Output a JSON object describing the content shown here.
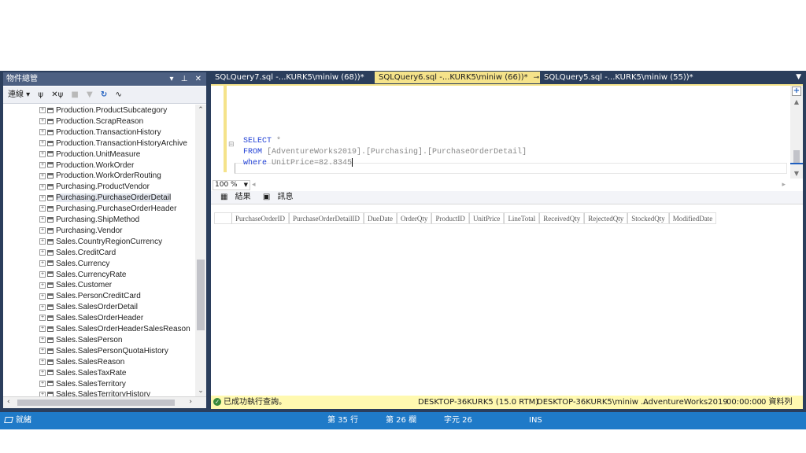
{
  "object_explorer": {
    "title": "物件總管",
    "title_buttons": "▾ ⊥ ✕",
    "toolbar": {
      "connect_label": "連線 ▾",
      "icons": [
        "plug-icon",
        "disconnect-icon",
        "stop-icon",
        "filter-icon",
        "refresh-icon",
        "activity-icon"
      ]
    },
    "items": [
      "Production.ProductSubcategory",
      "Production.ScrapReason",
      "Production.TransactionHistory",
      "Production.TransactionHistoryArchive",
      "Production.UnitMeasure",
      "Production.WorkOrder",
      "Production.WorkOrderRouting",
      "Purchasing.ProductVendor",
      "Purchasing.PurchaseOrderDetail",
      "Purchasing.PurchaseOrderHeader",
      "Purchasing.ShipMethod",
      "Purchasing.Vendor",
      "Sales.CountryRegionCurrency",
      "Sales.CreditCard",
      "Sales.Currency",
      "Sales.CurrencyRate",
      "Sales.Customer",
      "Sales.PersonCreditCard",
      "Sales.SalesOrderDetail",
      "Sales.SalesOrderHeader",
      "Sales.SalesOrderHeaderSalesReason",
      "Sales.SalesPerson",
      "Sales.SalesPersonQuotaHistory",
      "Sales.SalesReason",
      "Sales.SalesTaxRate",
      "Sales.SalesTerritory",
      "Sales.SalesTerritoryHistory"
    ],
    "selected_item": "Purchasing.PurchaseOrderDetail"
  },
  "tabs": [
    {
      "label": "SQLQuery7.sql -...KURK5\\miniw (68))*",
      "active": false
    },
    {
      "label": "SQLQuery6.sql -...KURK5\\miniw (66))*",
      "active": true
    },
    {
      "label": "SQLQuery5.sql -...KURK5\\miniw (55))*",
      "active": false
    }
  ],
  "editor": {
    "line1_kw": "SELECT",
    "line1_rest": " *",
    "line2_kw": "FROM",
    "line2_rest": " [AdventureWorks2019].[Purchasing].[PurchaseOrderDetail]",
    "line3_kw": "where",
    "line3_rest": " UnitPrice=82.8345",
    "zoom": "100 %"
  },
  "results": {
    "tabs": [
      "結果",
      "訊息"
    ],
    "columns": [
      "PurchaseOrderID",
      "PurchaseOrderDetailID",
      "DueDate",
      "OrderQty",
      "ProductID",
      "UnitPrice",
      "LineTotal",
      "ReceivedQty",
      "RejectedQty",
      "StockedQty",
      "ModifiedDate"
    ]
  },
  "query_status": {
    "message": "已成功執行查詢。",
    "server": "DESKTOP-36KURK5 (15.0 RTM)",
    "user": "DESKTOP-36KURK5\\miniw ...",
    "database": "AdventureWorks2019",
    "elapsed": "00:00:00",
    "rows": "0 資料列"
  },
  "app_status": {
    "ready": "就緒",
    "line": "第 35 行",
    "col": "第 26 欄",
    "char": "字元 26",
    "mode": "INS"
  },
  "colors": {
    "shell": "#2b3e5c",
    "active_tab": "#f5e38a",
    "status_bar": "#1f7ac8",
    "query_status": "#fff9b0",
    "keyword": "#1f3fd6"
  }
}
